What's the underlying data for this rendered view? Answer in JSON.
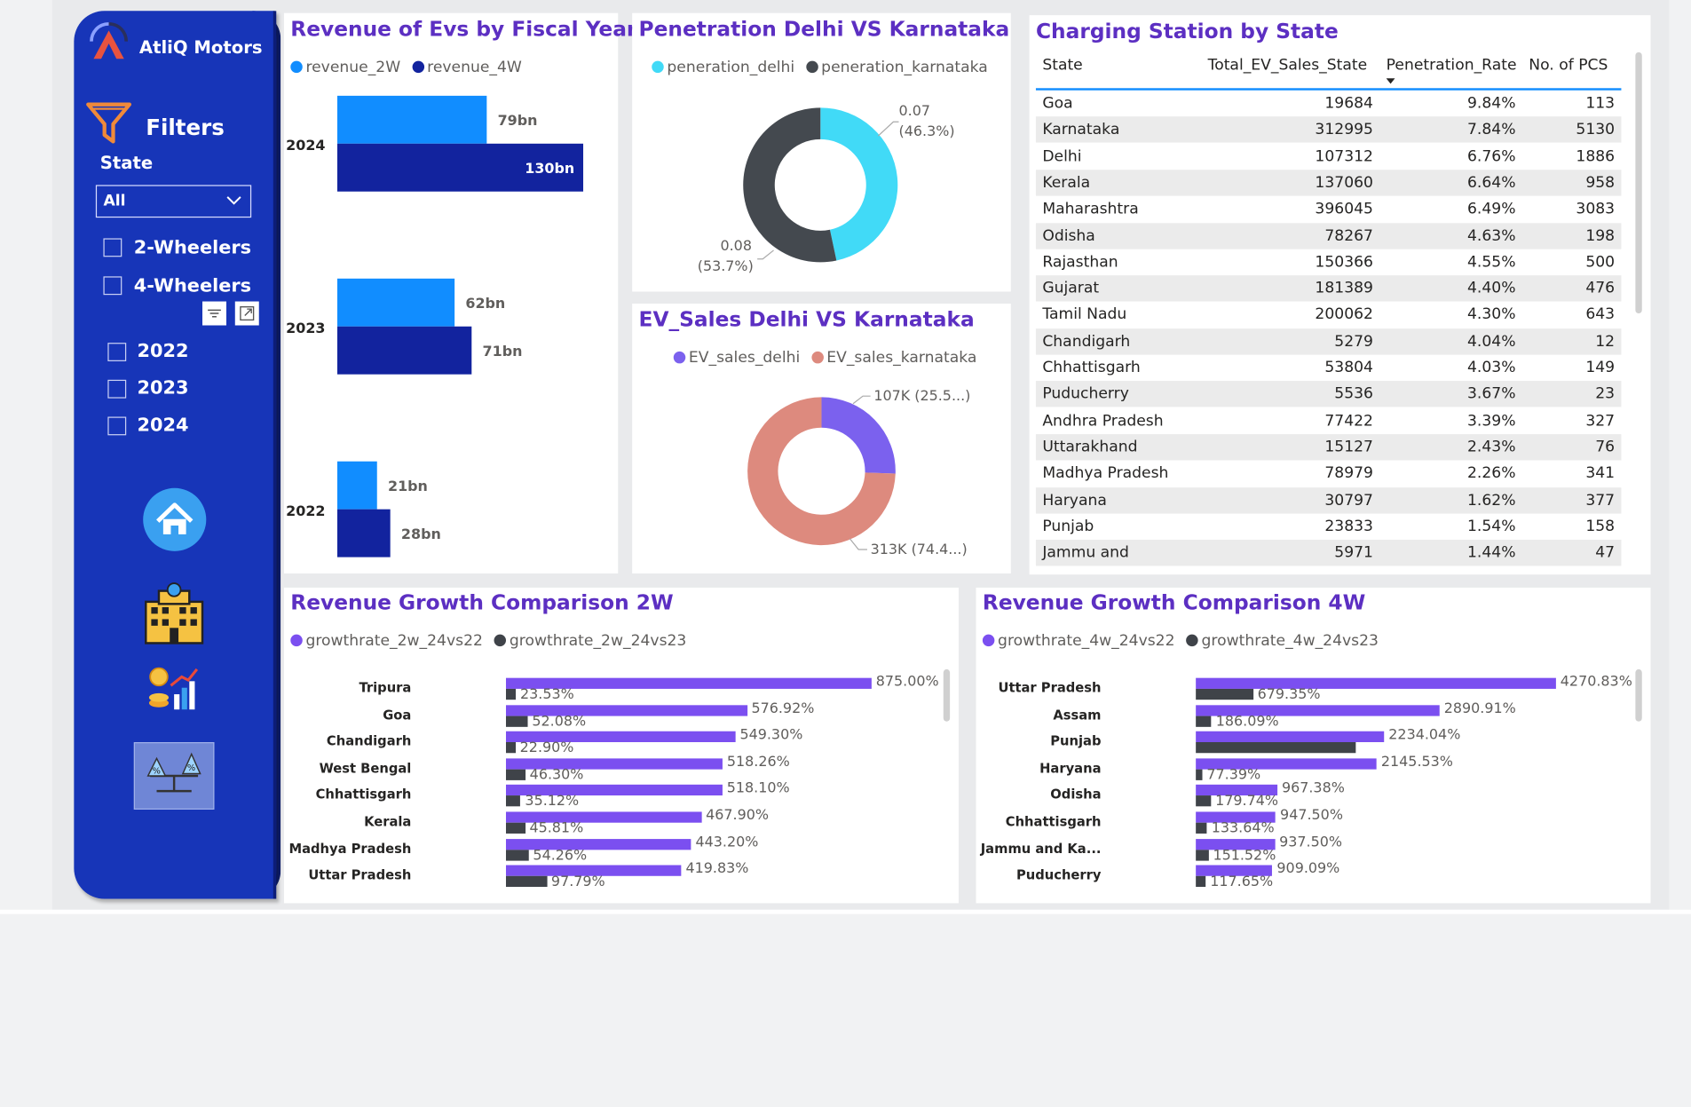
{
  "sidebar": {
    "brand": "AtliQ Motors",
    "filters_title": "Filters",
    "state_label": "State",
    "state_value": "All",
    "vehicle_options": [
      "2-Wheelers",
      "4-Wheelers"
    ],
    "year_options": [
      "2022",
      "2023",
      "2024"
    ],
    "icons": [
      "home-icon",
      "office-building-icon",
      "revenue-growth-icon",
      "percentage-comparison-icon"
    ]
  },
  "revenue_chart": {
    "title": "Revenue of Evs by Fiscal Year",
    "legend": [
      "revenue_2W",
      "revenue_4W"
    ],
    "colors": {
      "rev2w": "#118dff",
      "rev4w": "#12239e"
    },
    "chart_data": {
      "type": "bar",
      "categories": [
        "2024",
        "2023",
        "2022"
      ],
      "series": [
        {
          "name": "revenue_2W",
          "values": [
            79,
            62,
            21
          ],
          "labels": [
            "79bn",
            "62bn",
            "21bn"
          ]
        },
        {
          "name": "revenue_4W",
          "values": [
            130,
            71,
            28
          ],
          "labels": [
            "130bn",
            "71bn",
            "28bn"
          ]
        }
      ],
      "xlim": [
        0,
        130
      ]
    }
  },
  "penetration_chart": {
    "title": "Penetration Delhi VS Karnataka",
    "legend": [
      "peneration_delhi",
      "peneration_karnataka"
    ],
    "colors": {
      "delhi": "#41daf7",
      "karnataka": "#44494f"
    },
    "chart_data": {
      "type": "pie",
      "categories": [
        "peneration_delhi",
        "peneration_karnataka"
      ],
      "values": [
        0.07,
        0.08
      ],
      "percent": [
        46.3,
        53.7
      ]
    },
    "label_delhi_value": "0.07",
    "label_delhi_pct": "(46.3%)",
    "label_karnataka_value": "0.08",
    "label_karnataka_pct": "(53.7%)"
  },
  "ev_sales_chart": {
    "title": "EV_Sales Delhi VS Karnataka",
    "legend": [
      "EV_sales_delhi",
      "EV_sales_karnataka"
    ],
    "colors": {
      "delhi": "#7b61ee",
      "karnataka": "#dd8a7e"
    },
    "chart_data": {
      "type": "pie",
      "categories": [
        "EV_sales_delhi",
        "EV_sales_karnataka"
      ],
      "values": [
        107312,
        312995
      ],
      "percent": [
        25.5,
        74.4
      ]
    },
    "label_delhi": "107K (25.5...)",
    "label_karnataka": "313K (74.4...)"
  },
  "charging_table": {
    "title": "Charging Station by State",
    "columns": [
      "State",
      "Total_EV_Sales_State",
      "Penetration_Rate",
      "No. of PCS"
    ],
    "rows": [
      [
        "Goa",
        "19684",
        "9.84%",
        "113"
      ],
      [
        "Karnataka",
        "312995",
        "7.84%",
        "5130"
      ],
      [
        "Delhi",
        "107312",
        "6.76%",
        "1886"
      ],
      [
        "Kerala",
        "137060",
        "6.64%",
        "958"
      ],
      [
        "Maharashtra",
        "396045",
        "6.49%",
        "3083"
      ],
      [
        "Odisha",
        "78267",
        "4.63%",
        "198"
      ],
      [
        "Rajasthan",
        "150366",
        "4.55%",
        "500"
      ],
      [
        "Gujarat",
        "181389",
        "4.40%",
        "476"
      ],
      [
        "Tamil Nadu",
        "200062",
        "4.30%",
        "643"
      ],
      [
        "Chandigarh",
        "5279",
        "4.04%",
        "12"
      ],
      [
        "Chhattisgarh",
        "53804",
        "4.03%",
        "149"
      ],
      [
        "Puducherry",
        "5536",
        "3.67%",
        "23"
      ],
      [
        "Andhra Pradesh",
        "77422",
        "3.39%",
        "327"
      ],
      [
        "Uttarakhand",
        "15127",
        "2.43%",
        "76"
      ],
      [
        "Madhya Pradesh",
        "78979",
        "2.26%",
        "341"
      ],
      [
        "Haryana",
        "30797",
        "1.62%",
        "377"
      ],
      [
        "Punjab",
        "23833",
        "1.54%",
        "158"
      ],
      [
        "Jammu and",
        "5971",
        "1.44%",
        "47"
      ]
    ]
  },
  "growth_2w": {
    "title": "Revenue Growth Comparison 2W",
    "legend": [
      "growthrate_2w_24vs22",
      "growthrate_2w_24vs23"
    ],
    "colors": {
      "a": "#7b4ff0",
      "b": "#3f4349"
    },
    "chart_data": {
      "type": "bar",
      "categories": [
        "Tripura",
        "Goa",
        "Chandigarh",
        "West Bengal",
        "Chhattisgarh",
        "Kerala",
        "Madhya Pradesh",
        "Uttar Pradesh"
      ],
      "series": [
        {
          "name": "growthrate_2w_24vs22",
          "values": [
            875.0,
            576.92,
            549.3,
            518.26,
            518.1,
            467.9,
            443.2,
            419.83
          ],
          "labels": [
            "875.00%",
            "576.92%",
            "549.30%",
            "518.26%",
            "518.10%",
            "467.90%",
            "443.20%",
            "419.83%"
          ]
        },
        {
          "name": "growthrate_2w_24vs23",
          "values": [
            23.53,
            52.08,
            22.9,
            46.3,
            35.12,
            45.81,
            54.26,
            97.79
          ],
          "labels": [
            "23.53%",
            "52.08%",
            "22.90%",
            "46.30%",
            "35.12%",
            "45.81%",
            "54.26%",
            "97.79%"
          ]
        }
      ],
      "xlim": [
        0,
        875
      ]
    }
  },
  "growth_4w": {
    "title": "Revenue Growth Comparison 4W",
    "legend": [
      "growthrate_4w_24vs22",
      "growthrate_4w_24vs23"
    ],
    "colors": {
      "a": "#7b4ff0",
      "b": "#3f4349"
    },
    "chart_data": {
      "type": "bar",
      "categories": [
        "Uttar Pradesh",
        "Assam",
        "Punjab",
        "Haryana",
        "Odisha",
        "Chhattisgarh",
        "Jammu and Ka...",
        "Puducherry"
      ],
      "series": [
        {
          "name": "growthrate_4w_24vs22",
          "values": [
            4270.83,
            2890.91,
            2234.04,
            2145.53,
            967.38,
            947.5,
            937.5,
            909.09
          ],
          "labels": [
            "4270.83%",
            "2890.91%",
            "2234.04%",
            "2145.53%",
            "967.38%",
            "947.50%",
            "937.50%",
            "909.09%"
          ]
        },
        {
          "name": "growthrate_4w_24vs23",
          "values": [
            679.35,
            186.09,
            1900,
            77.39,
            179.74,
            133.64,
            151.52,
            117.65
          ],
          "labels": [
            "679.35%",
            "186.09%",
            "",
            "77.39%",
            "179.74%",
            "133.64%",
            "151.52%",
            "117.65%"
          ]
        }
      ],
      "xlim": [
        0,
        4270.83
      ]
    }
  }
}
